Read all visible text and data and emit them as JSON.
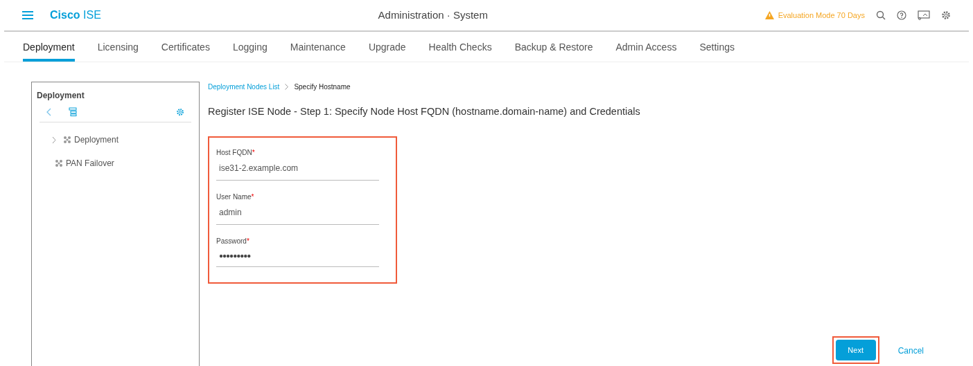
{
  "header": {
    "brand_bold": "Cisco",
    "brand_rest": "ISE",
    "title": "Administration · System",
    "notice": "Evaluation Mode 70 Days"
  },
  "tabs": [
    {
      "label": "Deployment",
      "selected": true
    },
    {
      "label": "Licensing",
      "selected": false
    },
    {
      "label": "Certificates",
      "selected": false
    },
    {
      "label": "Logging",
      "selected": false
    },
    {
      "label": "Maintenance",
      "selected": false
    },
    {
      "label": "Upgrade",
      "selected": false
    },
    {
      "label": "Health Checks",
      "selected": false
    },
    {
      "label": "Backup & Restore",
      "selected": false
    },
    {
      "label": "Admin Access",
      "selected": false
    },
    {
      "label": "Settings",
      "selected": false
    }
  ],
  "sidebar": {
    "title": "Deployment",
    "items": [
      {
        "label": "Deployment",
        "expanded": false
      },
      {
        "label": "PAN Failover"
      }
    ]
  },
  "breadcrumb": [
    {
      "label": "Deployment Nodes List",
      "kind": "link"
    },
    {
      "label": "Specify Hostname",
      "kind": "current"
    }
  ],
  "heading": "Register ISE Node - Step 1: Specify Node Host FQDN (hostname.domain-name) and Credentials",
  "form": {
    "highlighted": true,
    "fields": [
      {
        "label": "Host FQDN",
        "required_mark": "*",
        "value": "ise31-2.example.com"
      },
      {
        "label": "User Name",
        "required_mark": "*",
        "value": "admin"
      },
      {
        "label": "Password",
        "required_mark": "*",
        "value": "●●●●●●●●●"
      }
    ]
  },
  "buttons": [
    {
      "label": "Next",
      "kind": "primary",
      "highlighted": true
    },
    {
      "label": "Cancel",
      "kind": "link"
    }
  ]
}
